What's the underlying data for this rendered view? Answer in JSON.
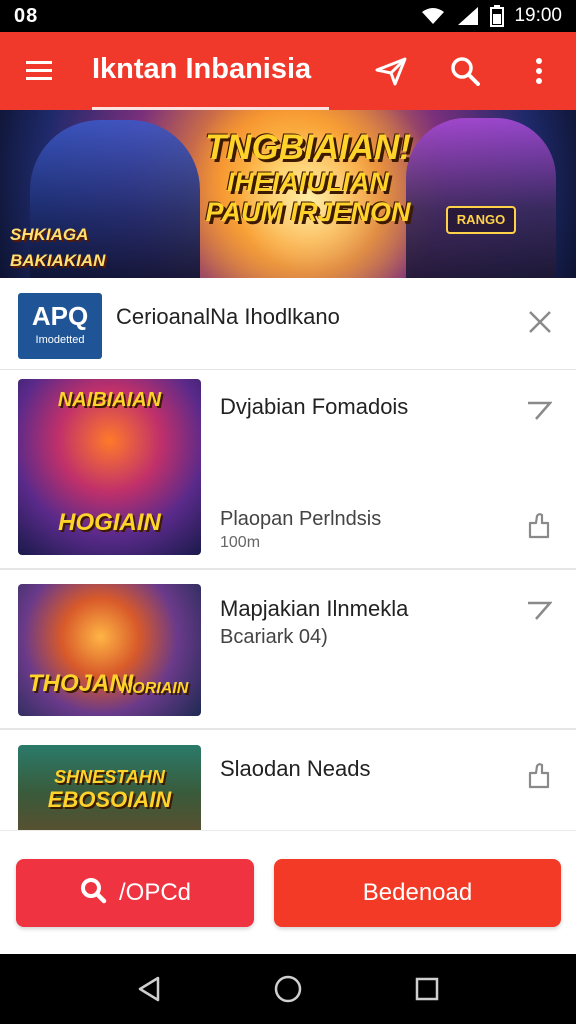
{
  "status_bar": {
    "left_text": "08",
    "time": "19:00",
    "icons": [
      "wifi-icon",
      "signal-icon",
      "battery-icon"
    ]
  },
  "app_bar": {
    "title": "Ikntan Inbanisia",
    "actions": [
      "send-icon",
      "search-icon",
      "more-vert-icon"
    ],
    "color": "#f0382b"
  },
  "banner": {
    "line1": "TNGBIAIAN!",
    "line2": "IHEIAIULIAN",
    "line3": "PAUM IRJENON",
    "tag_left": "SHKIAGA BAKIAKIAN",
    "tag_right": "RANGO"
  },
  "ad": {
    "logo_main": "APQ",
    "logo_sub": "Imodetted",
    "title": "CerioanalNa Ihodlkano"
  },
  "items": [
    {
      "thumb_top": "NAIBIAIAN",
      "thumb_label": "HOGIAIN",
      "title": "Dvjabian Fomadois",
      "subtitle": "Plaopan Perlndsis",
      "meta": "100m"
    },
    {
      "thumb_label": "THOJANI",
      "thumb_label2": "NORIAIN",
      "title": "Mapjakian Ilnmekla",
      "subtitle": "Bcariark 04)"
    },
    {
      "thumb_top": "SHNESTAHN",
      "thumb_label": "EBOSOIAIN",
      "title": "Slaodan Neads"
    }
  ],
  "buttons": {
    "left_label": "/OPCd",
    "right_label": "Bedenoad"
  },
  "nav": [
    "back-icon",
    "home-icon",
    "recents-icon"
  ]
}
